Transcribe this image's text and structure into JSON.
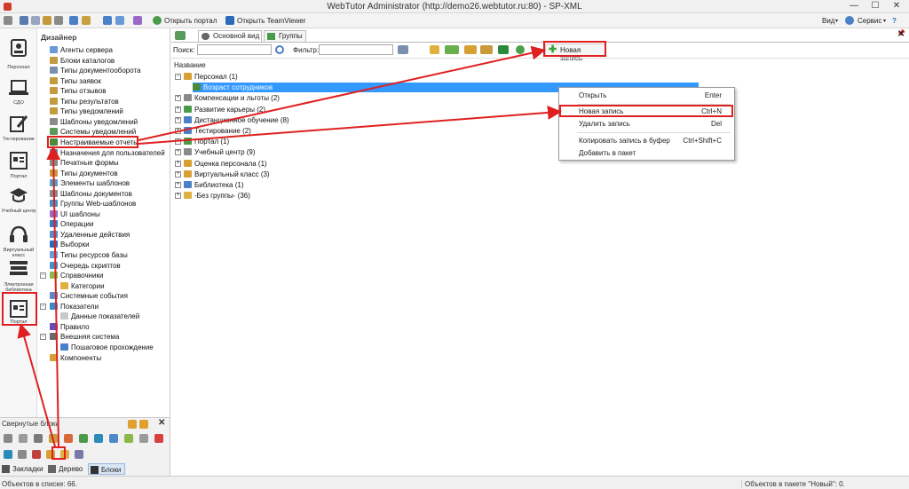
{
  "window": {
    "title": "WebTutor Administrator (http://demo26.webtutor.ru:80) - SP-XML",
    "minimize": "—",
    "maximize": "☐",
    "close": "✕"
  },
  "toolbar": {
    "open_portal": "Открыть портал",
    "open_teamviewer": "Открыть TeamViewer",
    "view_menu": "Вид",
    "service_menu": "Сервис"
  },
  "rail": [
    {
      "label": "Персонал",
      "icon": "person-card-icon"
    },
    {
      "label": "СДО",
      "icon": "laptop-icon"
    },
    {
      "label": "Тестирование",
      "icon": "pencil-note-icon"
    },
    {
      "label": "Портал",
      "icon": "portal-icon"
    },
    {
      "label": "Учебный центр",
      "icon": "graduation-cap-icon"
    },
    {
      "label": "Виртуальный класс",
      "icon": "headset-icon"
    },
    {
      "label": "Электронная библиотека",
      "icon": "books-icon"
    },
    {
      "label": "Портал",
      "icon": "portal-icon"
    }
  ],
  "designer": {
    "title": "Дизайнер",
    "items": [
      {
        "label": "Агенты сервера",
        "color": "#6a9ad8"
      },
      {
        "label": "Блоки каталогов",
        "color": "#c49a3e"
      },
      {
        "label": "Типы документооборота",
        "color": "#7a8fb0"
      },
      {
        "label": "Типы заявок",
        "color": "#c49a3e"
      },
      {
        "label": "Типы отзывов",
        "color": "#c49a3e"
      },
      {
        "label": "Типы результатов",
        "color": "#c49a3e"
      },
      {
        "label": "Типы уведомлений",
        "color": "#c49a3e"
      },
      {
        "label": "Шаблоны уведомлений",
        "color": "#8a8a8a"
      },
      {
        "label": "Системы уведомлений",
        "color": "#5a9a5a"
      },
      {
        "label": "Настраиваемые отчеты",
        "color": "#4a8a3a"
      },
      {
        "label": "Назначения для пользователей",
        "color": "#5a8ac8"
      },
      {
        "label": "Печатные формы",
        "color": "#8a8a8a"
      },
      {
        "label": "Типы документов",
        "color": "#c49a3e"
      },
      {
        "label": "Элементы шаблонов",
        "color": "#4aa0c8"
      },
      {
        "label": "Шаблоны документов",
        "color": "#8a8a8a"
      },
      {
        "label": "Группы Web-шаблонов",
        "color": "#4a90c8"
      },
      {
        "label": "UI шаблоны",
        "color": "#9a6ac8"
      },
      {
        "label": "Операции",
        "color": "#3a78c8"
      },
      {
        "label": "Удаленные действия",
        "color": "#5a8ac8"
      },
      {
        "label": "Выборки",
        "color": "#2a6ab8"
      },
      {
        "label": "Типы ресурсов базы",
        "color": "#6a9ad8"
      },
      {
        "label": "Очередь скриптов",
        "color": "#4a90c8"
      },
      {
        "label": "Справочники",
        "color": "#8ab84a"
      },
      {
        "label": "Категории",
        "color": "#e0b040"
      },
      {
        "label": "Системные события",
        "color": "#5a8ac8"
      },
      {
        "label": "Показатели",
        "color": "#3a8ac8"
      },
      {
        "label": "Данные показателей",
        "color": "#c8c8c8"
      },
      {
        "label": "Правило",
        "color": "#6a4ab8"
      },
      {
        "label": "Внешняя система",
        "color": "#6a6a6a"
      },
      {
        "label": "Пошаговое прохождение",
        "color": "#4a80c8"
      },
      {
        "label": "Компоненты",
        "color": "#d8a030"
      }
    ]
  },
  "collapsed": {
    "title": "Свернутые блоки",
    "tabs": [
      "Закладки",
      "Дерево",
      "Блоки"
    ]
  },
  "main": {
    "tabs": [
      "Основной вид",
      "Группы"
    ],
    "search_label": "Поиск:",
    "filter_label": "Фильтр:",
    "new_record_button": "Новая запись",
    "column_header": "Название",
    "tree": [
      {
        "label": "Персонал (1)",
        "color": "#d8a030",
        "expand": "⊟"
      },
      {
        "label": "Возраст сотрудников",
        "color": "#4a8a3a",
        "selected": true
      },
      {
        "label": "Компенсации и льготы (2)",
        "color": "#8a8a8a",
        "expand": "⊞"
      },
      {
        "label": "Развитие карьеры (2)",
        "color": "#4a9a4a",
        "expand": "⊞"
      },
      {
        "label": "Дистанционное обучение (8)",
        "color": "#4a80c8",
        "expand": "⊞"
      },
      {
        "label": "Тестирование (2)",
        "color": "#4a80c8",
        "expand": "⊞"
      },
      {
        "label": "Портал (1)",
        "color": "#4a9a4a",
        "expand": "⊞"
      },
      {
        "label": "Учебный центр (9)",
        "color": "#8a8a8a",
        "expand": "⊞"
      },
      {
        "label": "Оценка персонала (1)",
        "color": "#d8a030",
        "expand": "⊞"
      },
      {
        "label": "Виртуальный класс (3)",
        "color": "#d8a030",
        "expand": "⊞"
      },
      {
        "label": "Библиотека (1)",
        "color": "#4a80c8",
        "expand": "⊞"
      },
      {
        "label": "-Без группы- (36)",
        "color": "#e0b040",
        "expand": "⊞"
      }
    ]
  },
  "context_menu": [
    {
      "label": "Открыть",
      "shortcut": "Enter"
    },
    {
      "label": "Новая запись",
      "shortcut": "Ctrl+N"
    },
    {
      "label": "Удалить запись",
      "shortcut": "Del"
    },
    {
      "label": "Копировать запись в буфер",
      "shortcut": "Ctrl+Shift+C"
    },
    {
      "label": "Добавить в пакет",
      "shortcut": ""
    }
  ],
  "status": {
    "left": "Объектов в списке: 66.",
    "right": "Объектов в пакете \"Новый\": 0."
  },
  "colors": {
    "selection": "#3399ff",
    "annotation": "#e02020",
    "accent_green": "#3aa03a"
  }
}
